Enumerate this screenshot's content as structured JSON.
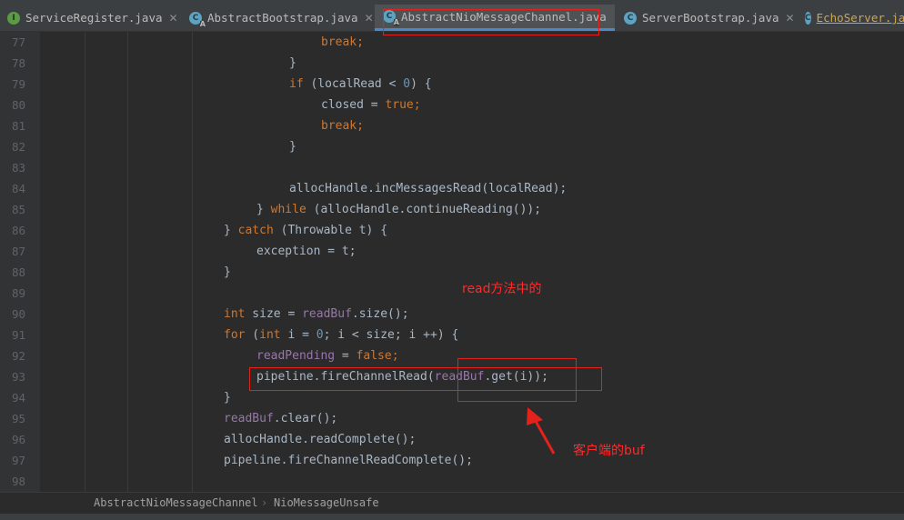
{
  "tabs": [
    {
      "label": "ServiceRegister.java",
      "icon": "interface",
      "closable": true,
      "active": false
    },
    {
      "label": "AbstractBootstrap.java",
      "icon": "abstract-class",
      "closable": true,
      "active": false
    },
    {
      "label": "AbstractNioMessageChannel.java",
      "icon": "abstract-class",
      "closable": false,
      "active": true
    },
    {
      "label": "ServerBootstrap.java",
      "icon": "class",
      "closable": true,
      "active": false
    },
    {
      "label": "EchoServer.ja",
      "icon": "class",
      "closable": false,
      "active": false
    }
  ],
  "close_glyph": "✕",
  "line_numbers": [
    "77",
    "78",
    "79",
    "80",
    "81",
    "82",
    "83",
    "84",
    "85",
    "86",
    "87",
    "88",
    "89",
    "90",
    "91",
    "92",
    "93",
    "94",
    "95",
    "96",
    "97",
    "98"
  ],
  "code_lines": [
    [
      {
        "t": "break;",
        "c": "kw"
      }
    ],
    [
      {
        "t": "}",
        "c": ""
      }
    ],
    [
      {
        "t": "if",
        "c": "kw"
      },
      {
        "t": " (localRead < ",
        "c": ""
      },
      {
        "t": "0",
        "c": "num"
      },
      {
        "t": ") {",
        "c": ""
      }
    ],
    [
      {
        "t": "closed = ",
        "c": ""
      },
      {
        "t": "true;",
        "c": "kw"
      }
    ],
    [
      {
        "t": "break;",
        "c": "kw"
      }
    ],
    [
      {
        "t": "}",
        "c": ""
      }
    ],
    [],
    [
      {
        "t": "allocHandle.incMessagesRead(localRead);",
        "c": ""
      }
    ],
    [
      {
        "t": "} ",
        "c": ""
      },
      {
        "t": "while",
        "c": "kw"
      },
      {
        "t": " (allocHandle.continueReading());",
        "c": ""
      }
    ],
    [
      {
        "t": "} ",
        "c": ""
      },
      {
        "t": "catch",
        "c": "kw"
      },
      {
        "t": " (Throwable t) {",
        "c": ""
      }
    ],
    [
      {
        "t": "exception = t;",
        "c": ""
      }
    ],
    [
      {
        "t": "}",
        "c": ""
      }
    ],
    [],
    [
      {
        "t": "int",
        "c": "kw"
      },
      {
        "t": " size = ",
        "c": ""
      },
      {
        "t": "readBuf",
        "c": "fld"
      },
      {
        "t": ".size();",
        "c": ""
      }
    ],
    [
      {
        "t": "for",
        "c": "kw"
      },
      {
        "t": " (",
        "c": ""
      },
      {
        "t": "int",
        "c": "kw"
      },
      {
        "t": " i = ",
        "c": ""
      },
      {
        "t": "0",
        "c": "num"
      },
      {
        "t": "; i < size; i ++) {",
        "c": ""
      }
    ],
    [
      {
        "t": "readPending",
        "c": "fld"
      },
      {
        "t": " = ",
        "c": ""
      },
      {
        "t": "false;",
        "c": "kw"
      }
    ],
    [
      {
        "t": "pipeline.fireChannelRead(",
        "c": ""
      },
      {
        "t": "readBuf",
        "c": "fld"
      },
      {
        "t": ".get(i));",
        "c": ""
      }
    ],
    [
      {
        "t": "}",
        "c": ""
      }
    ],
    [
      {
        "t": "readBuf",
        "c": "fld"
      },
      {
        "t": ".clear();",
        "c": ""
      }
    ],
    [
      {
        "t": "allocHandle.readComplete();",
        "c": ""
      }
    ],
    [
      {
        "t": "pipeline.fireChannelReadComplete();",
        "c": ""
      }
    ],
    []
  ],
  "annotations": {
    "note_read": "read方法中的",
    "note_client_buf": "客户端的buf"
  },
  "breadcrumb": [
    "AbstractNioMessageChannel",
    "NioMessageUnsafe"
  ],
  "breadcrumb_sep": "›",
  "colors": {
    "annotation": "#e3221b",
    "keyword": "#cc7832",
    "field": "#9876aa",
    "number": "#6897bb",
    "text": "#a9b7c6"
  }
}
